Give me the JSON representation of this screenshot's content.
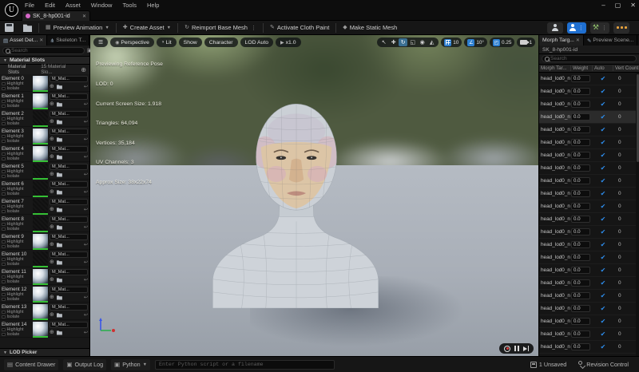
{
  "window": {
    "menus": [
      "File",
      "Edit",
      "Asset",
      "Window",
      "Tools",
      "Help"
    ],
    "controls": {
      "minimize": "–",
      "maximize": "▢",
      "close": "✕"
    }
  },
  "doc_tab": {
    "label": "SK_8-hp001-id",
    "close": "✕"
  },
  "toolbar": {
    "preview_animation": "Preview Animation",
    "create_asset": "Create Asset",
    "reimport_base_mesh": "Reimport Base Mesh",
    "activate_cloth_paint": "Activate Cloth Paint",
    "make_static_mesh": "Make Static Mesh"
  },
  "left_panel": {
    "tab_asset_details": "Asset Det...",
    "tab_skeleton_tree": "Skeleton T...",
    "search_placeholder": "Search",
    "section_title": "Material Slots",
    "slots_label": "Material Slots",
    "slots_count": "15 Material Slo...",
    "highlight_label": "Highlight",
    "isolate_label": "Isolate",
    "material_name": "M_Mat...",
    "elements": [
      {
        "name": "Element 0",
        "thumb": "sphere"
      },
      {
        "name": "Element 1",
        "thumb": "sphere"
      },
      {
        "name": "Element 2",
        "thumb": "dark"
      },
      {
        "name": "Element 3",
        "thumb": "sphere"
      },
      {
        "name": "Element 4",
        "thumb": "sphere"
      },
      {
        "name": "Element 5",
        "thumb": "dark"
      },
      {
        "name": "Element 6",
        "thumb": "dark"
      },
      {
        "name": "Element 7",
        "thumb": "dark"
      },
      {
        "name": "Element 8",
        "thumb": "dark"
      },
      {
        "name": "Element 9",
        "thumb": "sphere"
      },
      {
        "name": "Element 10",
        "thumb": "dark"
      },
      {
        "name": "Element 11",
        "thumb": "sphere"
      },
      {
        "name": "Element 12",
        "thumb": "sphere"
      },
      {
        "name": "Element 13",
        "thumb": "sphere"
      },
      {
        "name": "Element 14",
        "thumb": "sphere"
      }
    ],
    "footer": "LOD Picker"
  },
  "viewport": {
    "pills": {
      "perspective": "Perspective",
      "lit": "Lit",
      "show": "Show",
      "character": "Character",
      "lod": "LOD Auto",
      "speed": "x1.0"
    },
    "stats": {
      "line1": "Previewing Reference Pose",
      "line2": "LOD: 0",
      "line3": "Current Screen Size: 1.918",
      "line4": "Triangles: 64,094",
      "line5": "Vertices: 35,184",
      "line6": "UV Channels: 3",
      "line7": "Approx Size: 38x22x74"
    },
    "snap": {
      "grid": "10",
      "angle": "10°",
      "scale": "0.25",
      "camera_speed": "1"
    }
  },
  "right_panel": {
    "tab_morph": "Morph Targ...",
    "tab_preview_scene": "Preview Scene...",
    "asset_name": "SK_8-hp001-id",
    "search_placeholder": "Search",
    "columns": [
      "Morph Tar...",
      "Weight",
      "Auto",
      "Vert Count"
    ],
    "selected_row": 3,
    "rows": [
      {
        "name": "head_lod0_n",
        "weight": "0.0",
        "vert": "0"
      },
      {
        "name": "head_lod0_n",
        "weight": "0.0",
        "vert": "0"
      },
      {
        "name": "head_lod0_n",
        "weight": "0.0",
        "vert": "0"
      },
      {
        "name": "head_lod0_n",
        "weight": "0.0",
        "vert": "0"
      },
      {
        "name": "head_lod0_n",
        "weight": "0.0",
        "vert": "0"
      },
      {
        "name": "head_lod0_n",
        "weight": "0.0",
        "vert": "0"
      },
      {
        "name": "head_lod0_n",
        "weight": "0.0",
        "vert": "0"
      },
      {
        "name": "head_lod0_n",
        "weight": "0.0",
        "vert": "0"
      },
      {
        "name": "head_lod0_n",
        "weight": "0.0",
        "vert": "0"
      },
      {
        "name": "head_lod0_n",
        "weight": "0.0",
        "vert": "0"
      },
      {
        "name": "head_lod0_n",
        "weight": "0.0",
        "vert": "0"
      },
      {
        "name": "head_lod0_n",
        "weight": "0.0",
        "vert": "0"
      },
      {
        "name": "head_lod0_n",
        "weight": "0.0",
        "vert": "0"
      },
      {
        "name": "head_lod0_n",
        "weight": "0.0",
        "vert": "0"
      },
      {
        "name": "head_lod0_n",
        "weight": "0.0",
        "vert": "0"
      },
      {
        "name": "head_lod0_n",
        "weight": "0.0",
        "vert": "0"
      },
      {
        "name": "head_lod0_n",
        "weight": "0.0",
        "vert": "0"
      },
      {
        "name": "head_lod0_n",
        "weight": "0.0",
        "vert": "0"
      },
      {
        "name": "head_lod0_n",
        "weight": "0.0",
        "vert": "0"
      },
      {
        "name": "head_lod0_n",
        "weight": "0.0",
        "vert": "0"
      },
      {
        "name": "head_lod0_n",
        "weight": "0.0",
        "vert": "0"
      },
      {
        "name": "head_lod0_n",
        "weight": "0.0",
        "vert": "0"
      }
    ]
  },
  "status_bar": {
    "content_drawer": "Content Drawer",
    "output_log": "Output Log",
    "python": "Python",
    "cmd_placeholder": "Enter Python script or a filename",
    "unsaved": "1 Unsaved",
    "revision": "Revision Control"
  },
  "colors": {
    "accent_blue": "#1f6fd0",
    "check_blue": "#2d8ceb",
    "green_bar": "#35c035",
    "orange": "#e8a33d",
    "tab_asset_pink": "#d667c8"
  }
}
